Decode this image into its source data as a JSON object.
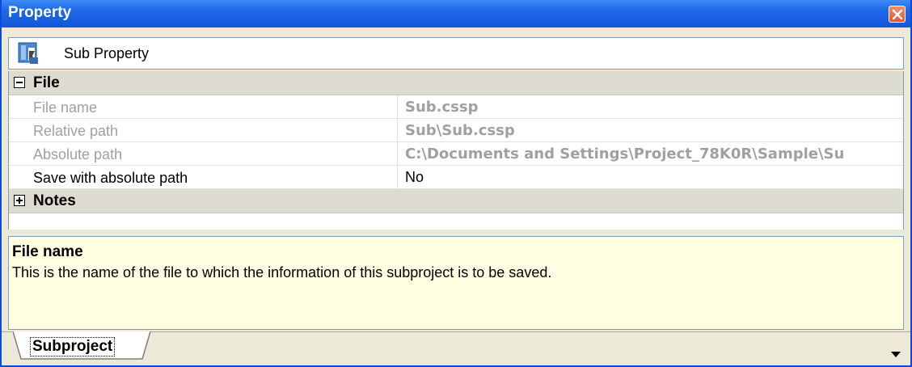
{
  "window": {
    "title": "Property"
  },
  "header": {
    "label": "Sub Property"
  },
  "categories": [
    {
      "label": "File",
      "expanded": true
    },
    {
      "label": "Notes",
      "expanded": false
    }
  ],
  "properties": [
    {
      "name": "File name",
      "value": "Sub.cssp"
    },
    {
      "name": "Relative path",
      "value": "Sub\\Sub.cssp"
    },
    {
      "name": "Absolute path",
      "value": "C:\\Documents and Settings\\Project_78K0R\\Sample\\Su"
    },
    {
      "name": "Save with absolute path",
      "value": "No"
    }
  ],
  "description": {
    "title": "File name",
    "text": "This is the name of the file to which the information of this subproject is to be saved."
  },
  "tabs": [
    {
      "label": "Subproject"
    }
  ],
  "icons": {
    "close": "close-icon",
    "header": "sub-property-icon",
    "collapse": "collapse-minus-icon",
    "expand": "expand-plus-icon",
    "dropdown": "dropdown-arrow-icon"
  },
  "colors": {
    "titlebar": "#1f6ae8",
    "category_bg": "#dedbd0",
    "description_bg": "#ffffe1",
    "readonly_text": "#a0a0a0"
  }
}
